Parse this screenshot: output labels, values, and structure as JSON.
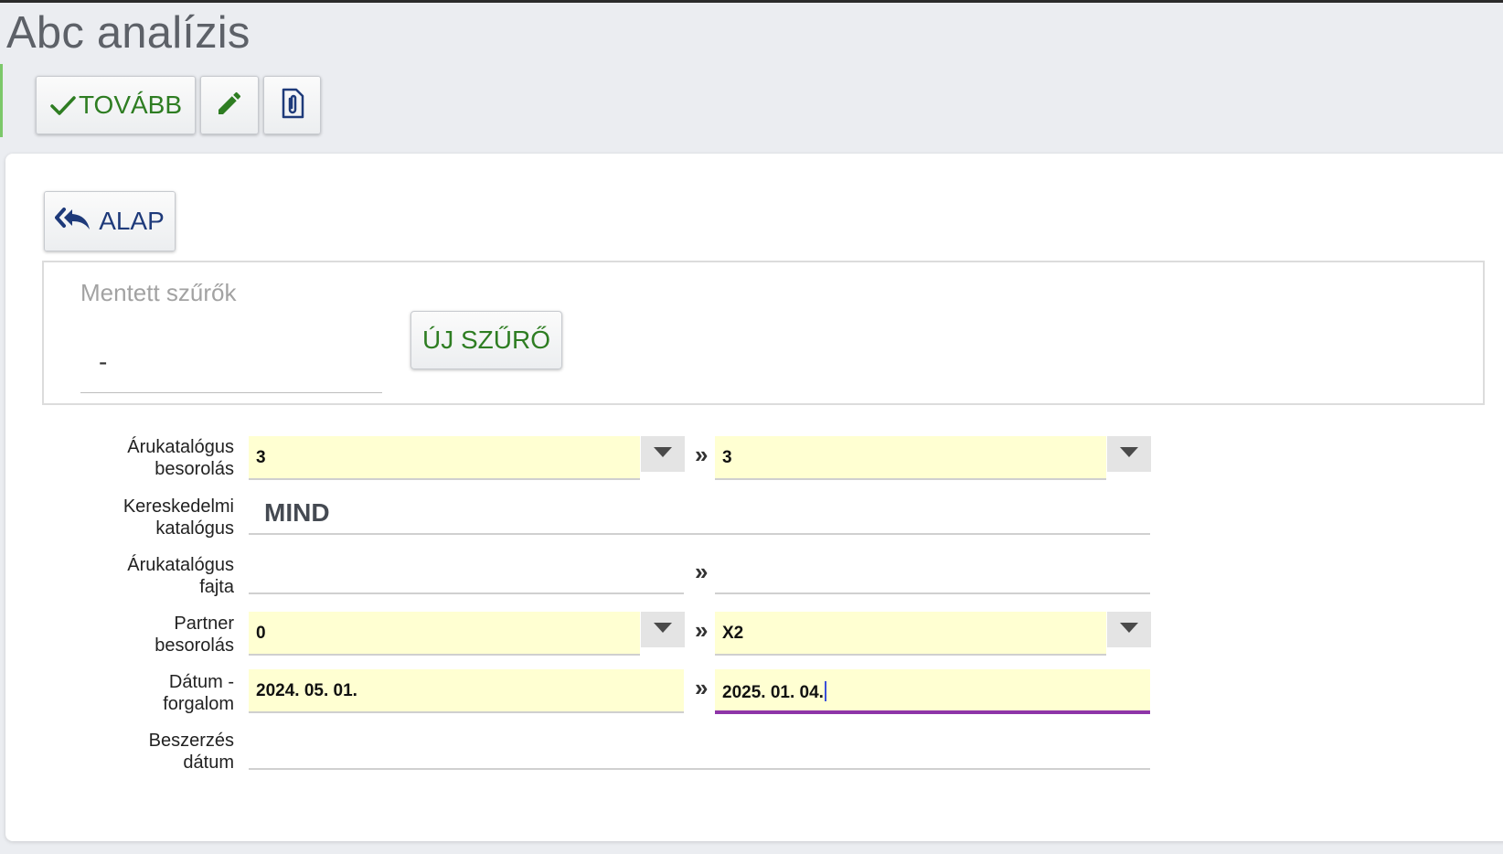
{
  "page": {
    "title": "Abc analízis"
  },
  "toolbar": {
    "continue_label": "TOVÁBB",
    "continue_icon": "check-icon",
    "edit_icon": "pencil-icon",
    "attach_icon": "paperclip-icon"
  },
  "panel": {
    "back_label": "ALAP",
    "back_icon": "reply-all-icon"
  },
  "saved_filters": {
    "label": "Mentett szűrők",
    "value": "-",
    "new_filter_label": "ÚJ SZŰRŐ"
  },
  "separator": "»",
  "filters": {
    "catalog_class": {
      "label_line1": "Árukatalógus",
      "label_line2": "besorolás",
      "from": "3",
      "to": "3"
    },
    "trade_catalog": {
      "label_line1": "Kereskedelmi",
      "label_line2": "katalógus",
      "value": "MIND"
    },
    "catalog_type": {
      "label_line1": "Árukatalógus",
      "label_line2": "fajta",
      "from": "",
      "to": ""
    },
    "partner_class": {
      "label_line1": "Partner",
      "label_line2": "besorolás",
      "from": "0",
      "to": "X2"
    },
    "date_turnover": {
      "label_line1": "Dátum -",
      "label_line2": "forgalom",
      "from": "2024. 05. 01.",
      "to": "2025. 01. 04."
    },
    "purchase_date": {
      "label_line1": "Beszerzés",
      "label_line2": "dátum",
      "value": ""
    }
  },
  "colors": {
    "accent_green": "#2e7d22",
    "accent_navy": "#1e3a7a",
    "field_bg": "#ffffd2",
    "focus_underline": "#8e35a8"
  }
}
